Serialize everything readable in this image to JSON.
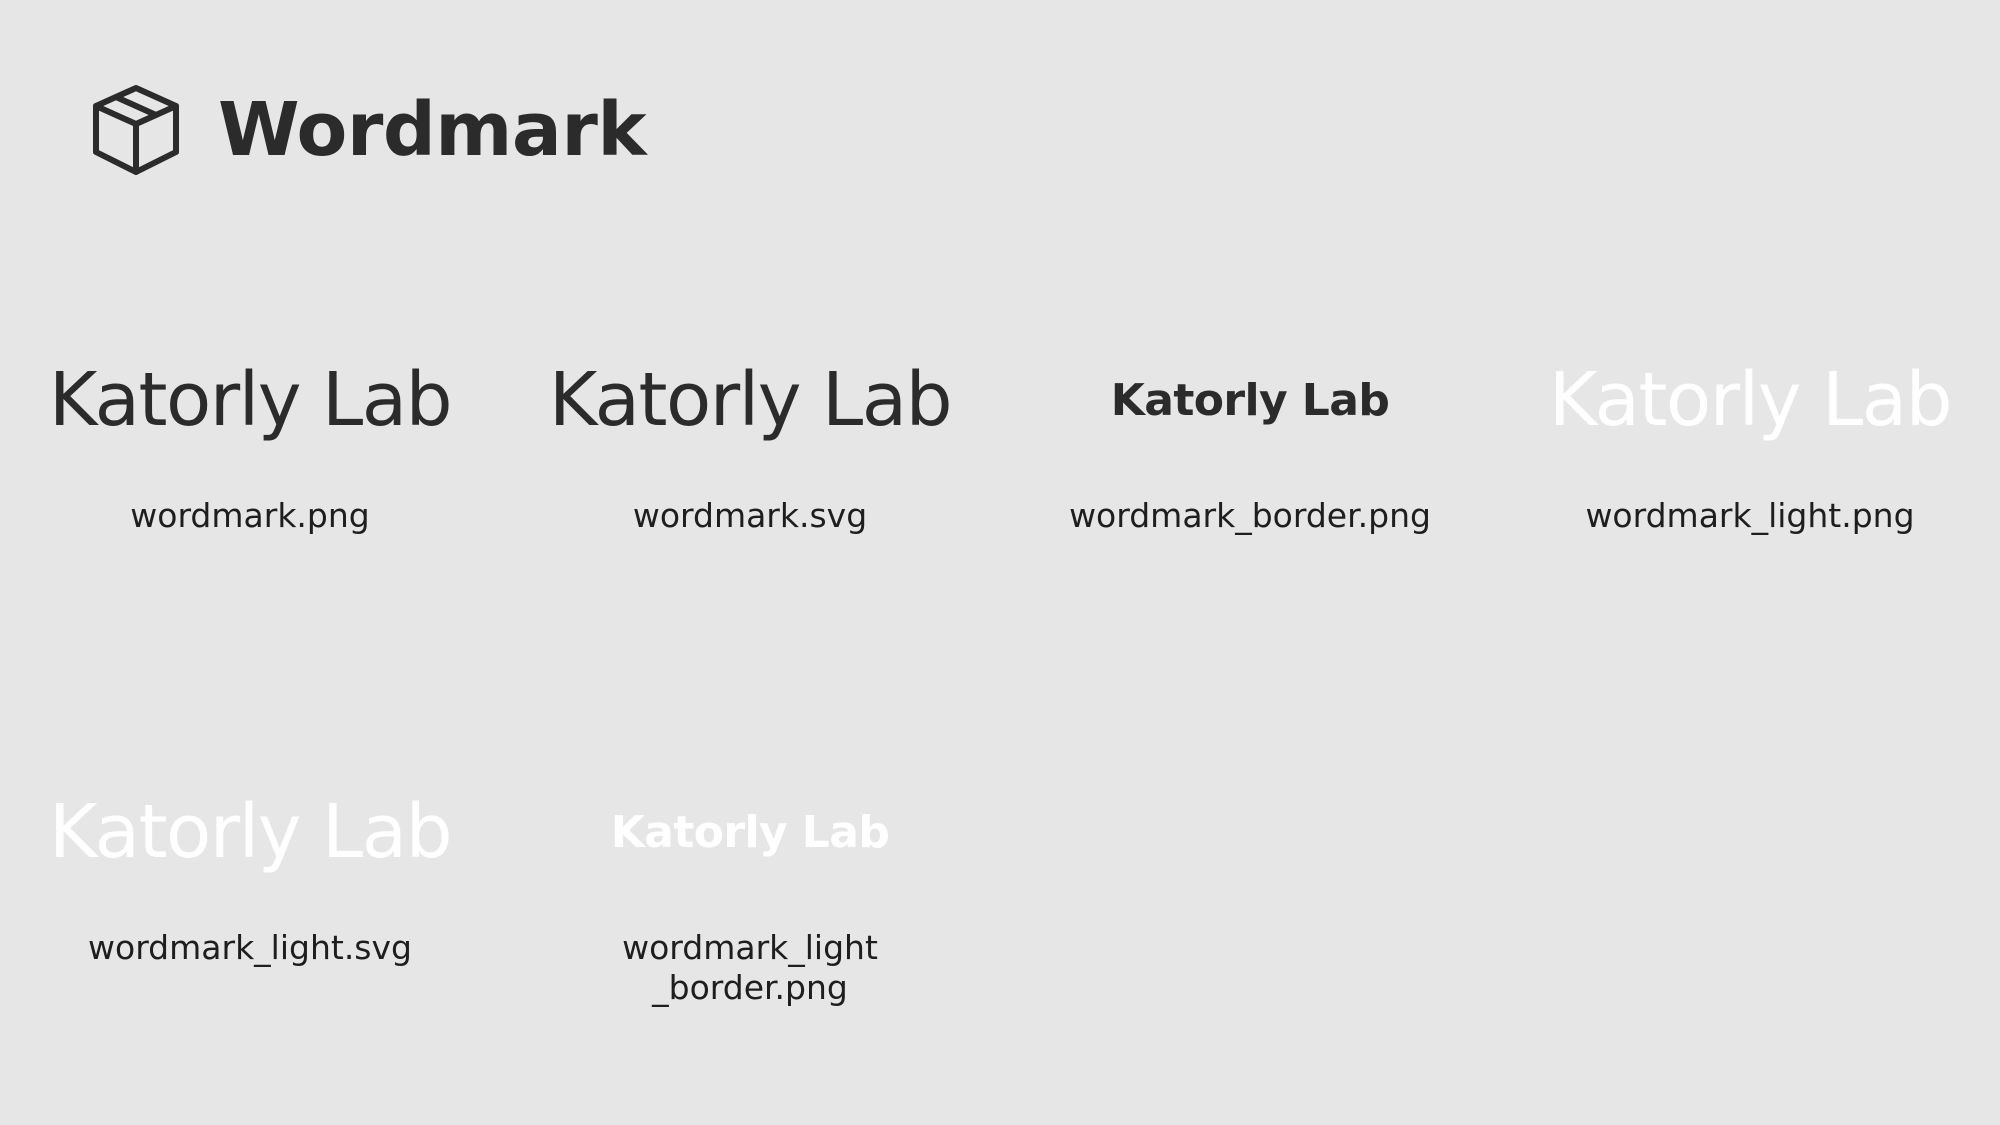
{
  "header": {
    "icon": "box-icon",
    "title": "Wordmark"
  },
  "tiles": [
    {
      "logo_text": "Katorly Lab",
      "variant": "dark",
      "filename": "wordmark.png"
    },
    {
      "logo_text": "Katorly Lab",
      "variant": "dark",
      "filename": "wordmark.svg"
    },
    {
      "logo_text": "Katorly Lab",
      "variant": "dark-bordered",
      "filename": "wordmark_border.png"
    },
    {
      "logo_text": "Katorly Lab",
      "variant": "light",
      "filename": "wordmark_light.png"
    },
    {
      "logo_text": "Katorly Lab",
      "variant": "light",
      "filename": "wordmark_light.svg"
    },
    {
      "logo_text": "Katorly Lab",
      "variant": "light-bordered",
      "filename": "wordmark_light\n_border.png"
    }
  ],
  "colors": {
    "background": "#e6e6e6",
    "dark_text": "#2b2b2b",
    "light_text": "#ffffff"
  }
}
